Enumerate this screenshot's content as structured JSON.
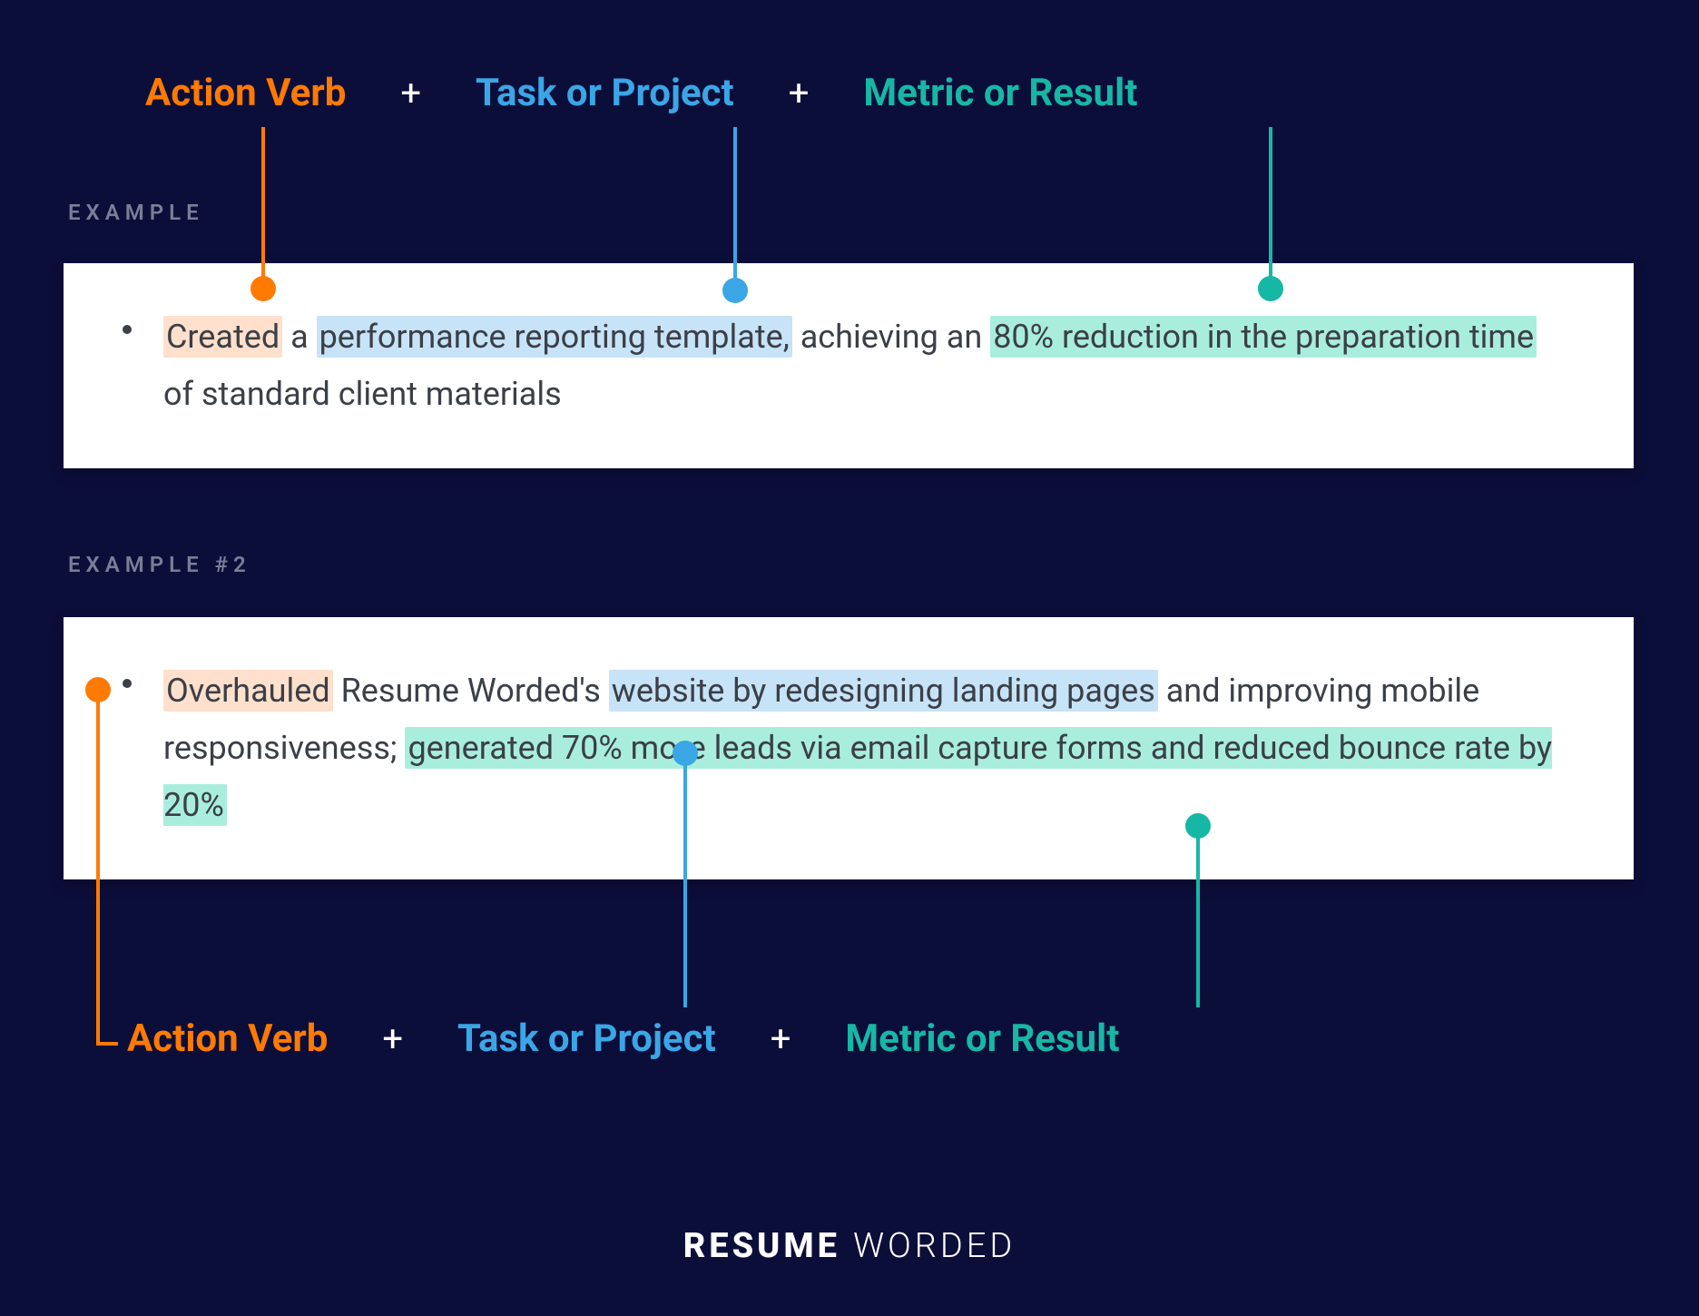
{
  "formula": {
    "action_verb": "Action Verb",
    "task": "Task or Project",
    "metric": "Metric or Result",
    "plus": "+"
  },
  "labels": {
    "example1": "EXAMPLE",
    "example2": "EXAMPLE #2"
  },
  "example1": {
    "seg1_hl": "Created",
    "seg2_plain": " a ",
    "seg3_hl": "performance reporting template,",
    "seg4_plain": " achieving an ",
    "seg5_hl": "80% reduction in the preparation time",
    "seg6_plain": " of standard client materials"
  },
  "example2": {
    "seg1_hl": "Overhauled",
    "seg2_plain": " Resume Worded's ",
    "seg3_hl": "website by redesigning landing pages",
    "seg4_plain": " and improving mobile responsiveness; ",
    "seg5_hl": "generated 70% more leads via email capture forms and reduced bounce rate by 20%"
  },
  "brand": {
    "part1": "RESUME",
    "part2": "WORDED"
  },
  "colors": {
    "orange": "#ff7a00",
    "blue": "#3ba6e6",
    "teal": "#17b7a6",
    "bg": "#0c0e3a"
  }
}
